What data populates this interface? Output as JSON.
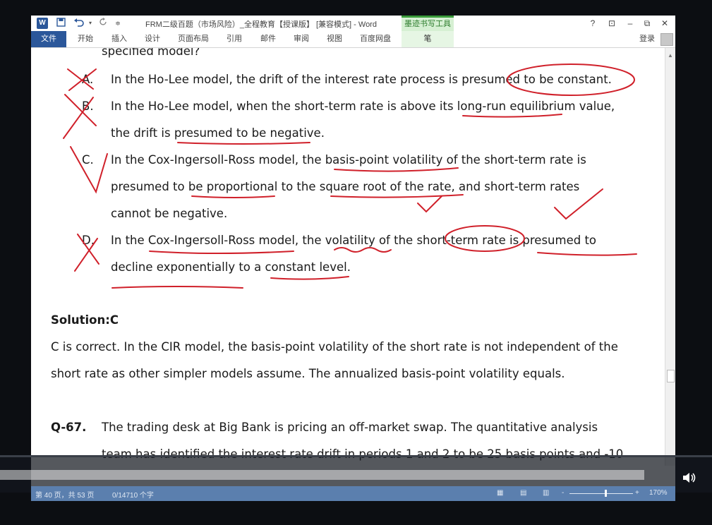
{
  "titlebar": {
    "word_logo": "W",
    "doc_title": "FRM二级百题（市场风险）_全程教育【授课版】 [兼容模式] - Word",
    "context_group": "墨迹书写工具",
    "help": "?",
    "ribbon_display": "⊡",
    "minimize": "–",
    "restore": "⧉",
    "close": "✕"
  },
  "ribbon": {
    "file_tab": "文件",
    "tabs": [
      "开始",
      "插入",
      "设计",
      "页面布局",
      "引用",
      "邮件",
      "审阅",
      "视图",
      "百度网盘"
    ],
    "pen_tab": "笔",
    "signin": "登录"
  },
  "document": {
    "partial_top": "specified model?",
    "options": [
      {
        "letter": "A.",
        "line1": "In the Ho-Lee model, the drift of the interest rate process is presumed to be constant."
      },
      {
        "letter": "B.",
        "line1": "In the Ho-Lee model, when the short-term rate is above its long-run equilibrium value,",
        "line2": "the drift is presumed to be negative."
      },
      {
        "letter": "C.",
        "line1": "In the Cox-Ingersoll-Ross model, the basis-point volatility of the short-term rate is",
        "line2": "presumed to be proportional to the square root of the rate, and short-term rates",
        "line3": "cannot be negative."
      },
      {
        "letter": "D.",
        "line1": "In the Cox-Ingersoll-Ross model, the volatility of the short-term rate is presumed to",
        "line2": "decline exponentially to a constant level."
      }
    ],
    "solution_heading": "Solution:C",
    "solution_line1": "C is correct. In the CIR model, the basis-point volatility of the short rate is not independent of the",
    "solution_line2": "short rate as other simpler models assume. The annualized basis-point volatility equals.",
    "q_label": "Q-67.",
    "q_line1": "The trading desk at Big Bank is pricing an off-market swap. The quantitative analysis",
    "q_line2": "team has identified the interest rate drift in periods 1 and 2 to be 25 basis points and -10"
  },
  "statusbar": {
    "page_info": "第 40 页，共 53 页",
    "word_count": "0/14710 个字",
    "zoom": "170%",
    "zoom_minus": "-",
    "zoom_plus": "+"
  },
  "annotation_color": "#d0202a",
  "icons": {
    "save": "save-icon",
    "undo": "undo-icon",
    "redo": "redo-icon",
    "volume": "volume-icon"
  }
}
